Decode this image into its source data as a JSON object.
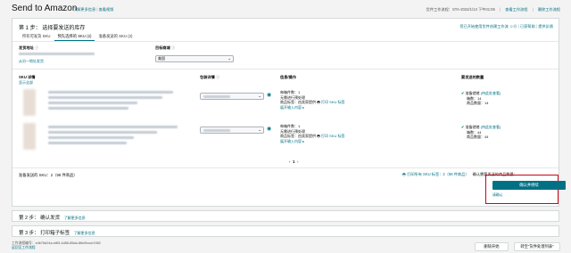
{
  "header": {
    "title": "Send to Amazon",
    "links": [
      "了解更多信息",
      "查看视频"
    ],
    "right_items": [
      "货件工作流程：STA-2022/1/13 下午01:05",
      "查看工作流程",
      "删除工作流程"
    ]
  },
  "step1": {
    "title": "第 1 步：  选择要发送的库存",
    "right_links": [
      "您已开始使用货件创建工作流",
      "反馈",
      "已获帮助",
      "提供反馈"
    ],
    "tabs": [
      "所有可发货 SKU",
      "预先选择的 SKU (2)",
      "准备发送的 SKU (2)"
    ],
    "ship_from_label": "发货地址",
    "ship_from_link": "从另一地址发货",
    "marketplace_label": "目标商城",
    "marketplace_value": "美国",
    "col_sku": "SKU 详情",
    "col_sku_link": "显示全部",
    "col_prep": "包装详情",
    "col_info": "信息/操作",
    "col_qty": "要发送的数量",
    "rows": [
      {
        "info": [
          "每箱件数：1",
          "无需进行预处理",
          "商品标签：由卖家提供"
        ],
        "print_link": "打印 SKU 标签",
        "expand_link": "展开输入内容",
        "qty_status": "准备就绪",
        "qty_status_link": "(待此处查看)",
        "qty_lines": [
          "箱数：14",
          "商品数量：14"
        ]
      },
      {
        "info": [
          "每箱件数：1",
          "无需进行预处理",
          "商品标签：由卖家提供"
        ],
        "print_link": "打印 SKU 标签",
        "expand_link": "展开输入内容",
        "qty_status": "准备就绪",
        "qty_status_link": "(待此处查看)",
        "qty_lines": [
          "箱数：44",
          "商品数量：44"
        ]
      }
    ],
    "pager": {
      "prev": "‹",
      "page": "1",
      "next": "›"
    },
    "ready_count": "准备发送的 SKU：2（98 件商品）",
    "print_all_link": "打印所有 SKU 标签：2（98 件商品）",
    "confirm_note": "确认需要发送的商品数量：",
    "confirm_button": "确认并继续",
    "confirm_sub": "请确认"
  },
  "step2": {
    "title": "第 2 步：  确认发货",
    "link": "了解更多信息"
  },
  "step3": {
    "title": "第 3 步：  打印箱子标签",
    "link": "了解更多信息"
  },
  "bottom": {
    "workflow_id_label": "工作流程编号：",
    "workflow_id": "e4b76d24a-e8f3-4d56-85da-86e0bcce1982",
    "back_link": "返回至工作流程",
    "delete_button": "删除开始",
    "save_button": "转至“货件处理列表”"
  },
  "colors": {
    "accent": "#007185",
    "highlight": "#d0021b",
    "success": "#067d62"
  }
}
